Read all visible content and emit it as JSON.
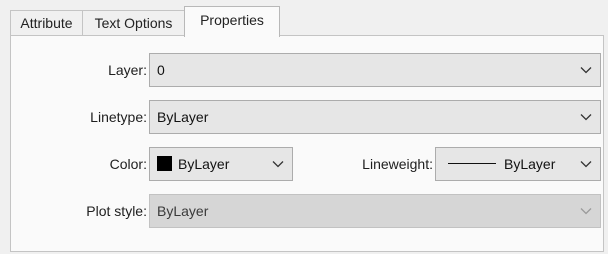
{
  "tabs": [
    {
      "label": "Attribute"
    },
    {
      "label": "Text Options"
    },
    {
      "label": "Properties"
    }
  ],
  "active_tab": "Properties",
  "fields": {
    "layer": {
      "label": "Layer:",
      "value": "0"
    },
    "linetype": {
      "label": "Linetype:",
      "value": "ByLayer"
    },
    "color": {
      "label": "Color:",
      "value": "ByLayer",
      "swatch": "#000000"
    },
    "lineweight": {
      "label": "Lineweight:",
      "value": "ByLayer"
    },
    "plot_style": {
      "label": "Plot style:",
      "value": "ByLayer",
      "disabled": true
    }
  }
}
